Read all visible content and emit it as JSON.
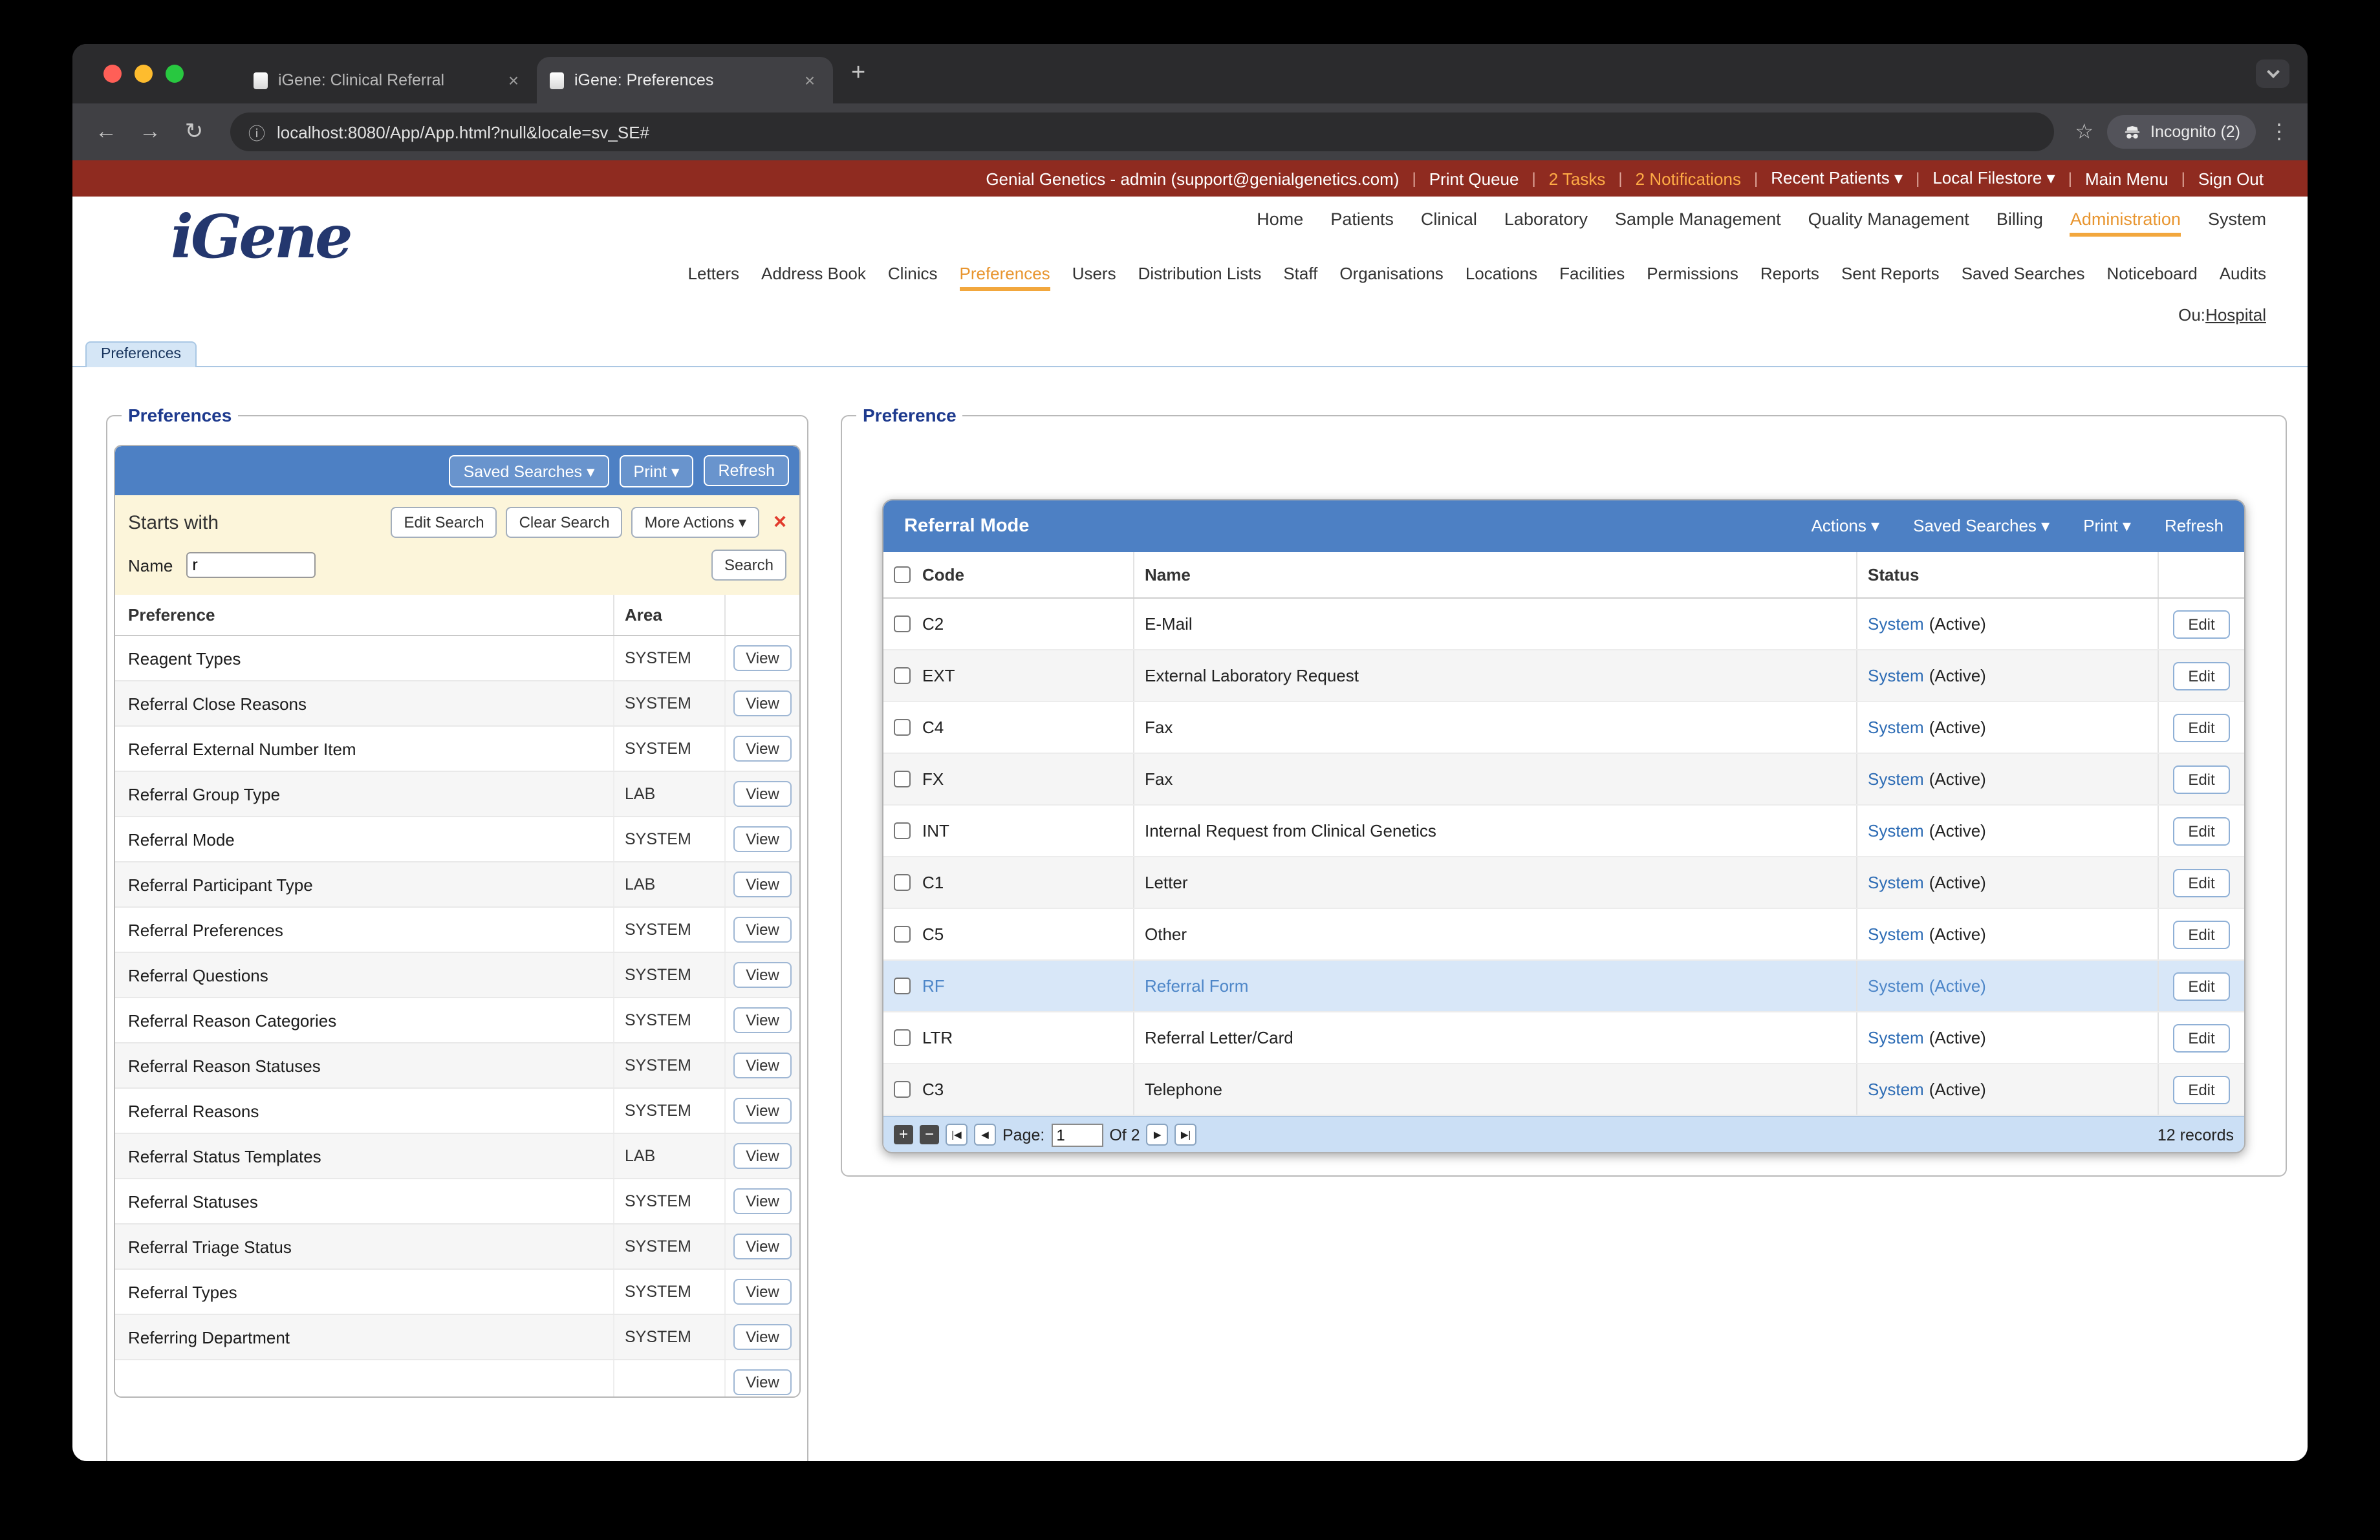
{
  "colors": {
    "accent_blue": "#4d80c4",
    "accent_orange": "#f2a73d",
    "top_bar_red": "#8f2b20",
    "link_blue": "#2d6cb5"
  },
  "browser": {
    "tab1": "iGene: Clinical Referral",
    "tab2": "iGene: Preferences",
    "url": "localhost:8080/App/App.html?null&locale=sv_SE#",
    "incognito": "Incognito (2)",
    "icons": {
      "close": "×",
      "new_tab": "+",
      "back": "←",
      "forward": "→",
      "reload": "↻",
      "info": "ⓘ",
      "star": "☆",
      "menu": "⋮"
    }
  },
  "topbar": {
    "account": "Genial Genetics - admin (support@genialgenetics.com)",
    "sep": "|",
    "print_queue": "Print Queue",
    "tasks": "2 Tasks",
    "notifications": "2 Notifications",
    "recent_patients": "Recent Patients ▾",
    "local_filestore": "Local Filestore ▾",
    "main_menu": "Main Menu",
    "sign_out": "Sign Out"
  },
  "logo": {
    "text": "iGene"
  },
  "nav_main": {
    "items": [
      "Home",
      "Patients",
      "Clinical",
      "Laboratory",
      "Sample Management",
      "Quality Management",
      "Billing",
      "Administration",
      "System"
    ]
  },
  "nav_sub": {
    "items": [
      "Letters",
      "Address Book",
      "Clinics",
      "Preferences",
      "Users",
      "Distribution Lists",
      "Staff",
      "Organisations",
      "Locations",
      "Facilities",
      "Permissions",
      "Reports",
      "Sent Reports",
      "Saved Searches",
      "Noticeboard",
      "Audits"
    ]
  },
  "ou": {
    "label": "Ou:",
    "link": "Hospital"
  },
  "page_tab": "Preferences",
  "left": {
    "legend": "Preferences",
    "toolbar": {
      "saved_searches": "Saved Searches ▾",
      "print": "Print ▾",
      "refresh": "Refresh"
    },
    "search": {
      "title": "Starts with",
      "edit": "Edit Search",
      "clear": "Clear Search",
      "more": "More Actions ▾",
      "close": "×",
      "name_label": "Name",
      "name_value": "r",
      "submit": "Search"
    },
    "headers": {
      "preference": "Preference",
      "area": "Area"
    },
    "view_label": "View",
    "rows": [
      {
        "name": "Reagent Types",
        "area": "SYSTEM"
      },
      {
        "name": "Referral Close Reasons",
        "area": "SYSTEM"
      },
      {
        "name": "Referral External Number Item",
        "area": "SYSTEM"
      },
      {
        "name": "Referral Group Type",
        "area": "LAB"
      },
      {
        "name": "Referral Mode",
        "area": "SYSTEM"
      },
      {
        "name": "Referral Participant Type",
        "area": "LAB"
      },
      {
        "name": "Referral Preferences",
        "area": "SYSTEM"
      },
      {
        "name": "Referral Questions",
        "area": "SYSTEM"
      },
      {
        "name": "Referral Reason Categories",
        "area": "SYSTEM"
      },
      {
        "name": "Referral Reason Statuses",
        "area": "SYSTEM"
      },
      {
        "name": "Referral Reasons",
        "area": "SYSTEM"
      },
      {
        "name": "Referral Status Templates",
        "area": "LAB"
      },
      {
        "name": "Referral Statuses",
        "area": "SYSTEM"
      },
      {
        "name": "Referral Triage Status",
        "area": "SYSTEM"
      },
      {
        "name": "Referral Types",
        "area": "SYSTEM"
      },
      {
        "name": "Referring Department",
        "area": "SYSTEM"
      }
    ]
  },
  "right": {
    "legend": "Preference",
    "card": {
      "title": "Referral Mode",
      "actions": "Actions ▾",
      "saved_searches": "Saved Searches ▾",
      "print": "Print ▾",
      "refresh": "Refresh"
    },
    "headers": {
      "code": "Code",
      "name": "Name",
      "status": "Status"
    },
    "edit_label": "Edit",
    "rows": [
      {
        "code": "C2",
        "name": "E-Mail",
        "status_link": "System",
        "status_rest": "(Active)"
      },
      {
        "code": "EXT",
        "name": "External Laboratory Request",
        "status_link": "System",
        "status_rest": "(Active)"
      },
      {
        "code": "C4",
        "name": "Fax",
        "status_link": "System",
        "status_rest": "(Active)"
      },
      {
        "code": "FX",
        "name": "Fax",
        "status_link": "System",
        "status_rest": "(Active)"
      },
      {
        "code": "INT",
        "name": "Internal Request from Clinical Genetics",
        "status_link": "System",
        "status_rest": "(Active)"
      },
      {
        "code": "C1",
        "name": "Letter",
        "status_link": "System",
        "status_rest": "(Active)"
      },
      {
        "code": "C5",
        "name": "Other",
        "status_link": "System",
        "status_rest": "(Active)"
      },
      {
        "code": "RF",
        "name": "Referral Form",
        "status_link": "System",
        "status_rest": "(Active)"
      },
      {
        "code": "LTR",
        "name": "Referral Letter/Card",
        "status_link": "System",
        "status_rest": "(Active)"
      },
      {
        "code": "C3",
        "name": "Telephone",
        "status_link": "System",
        "status_rest": "(Active)"
      }
    ],
    "pager": {
      "plus": "+",
      "minus": "−",
      "first": "|◀",
      "prev": "◀",
      "page_label": "Page:",
      "page_value": "1",
      "of": "Of 2",
      "next": "▶",
      "last": "▶|",
      "records": "12 records"
    }
  }
}
